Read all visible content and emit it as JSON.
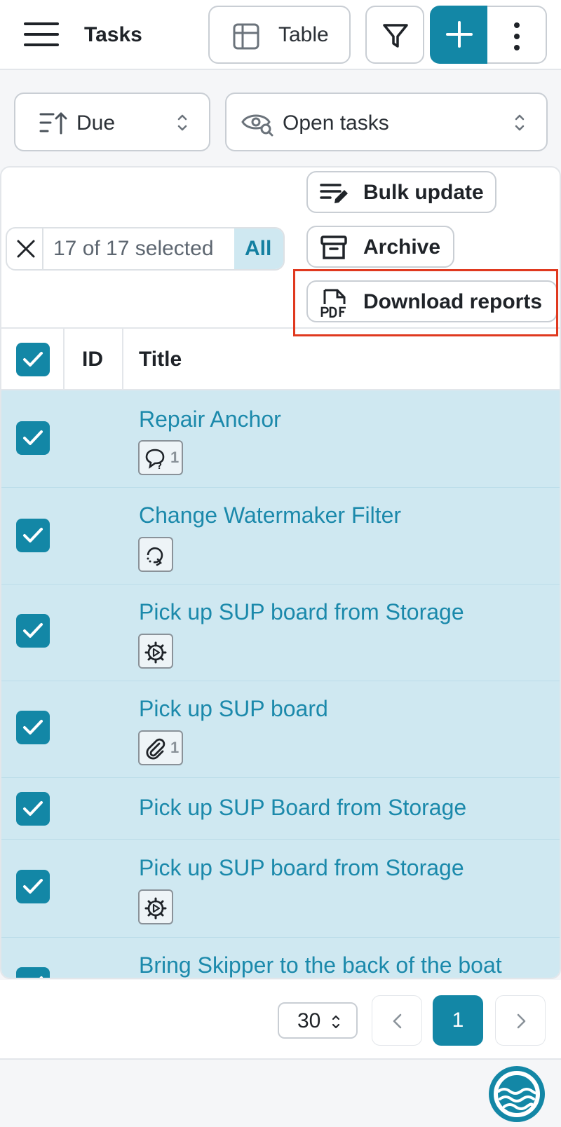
{
  "header": {
    "title": "Tasks",
    "view_button_label": "Table",
    "icons": [
      "menu-icon",
      "table-icon",
      "filter-icon",
      "plus-icon",
      "more-vertical-icon"
    ]
  },
  "toolbar": {
    "sort": {
      "label": "Due",
      "icon": "sort-icon"
    },
    "view_filter": {
      "label": "Open tasks",
      "icon": "eye-search-icon"
    }
  },
  "selection": {
    "count_text": "17 of 17 selected",
    "all_label": "All"
  },
  "actions": {
    "bulk_update": "Bulk update",
    "archive": "Archive",
    "download_reports": "Download reports"
  },
  "table": {
    "columns": [
      "ID",
      "Title"
    ],
    "rows": [
      {
        "title": "Repair Anchor",
        "badge_icon": "comment-question-icon",
        "badge_count": "1",
        "checked": true
      },
      {
        "title": "Change Watermaker Filter",
        "badge_icon": "recurring-icon",
        "badge_count": "",
        "checked": true
      },
      {
        "title": "Pick up SUP board from Storage",
        "badge_icon": "automation-gear-icon",
        "badge_count": "",
        "checked": true
      },
      {
        "title": "Pick up SUP board",
        "badge_icon": "paperclip-icon",
        "badge_count": "1",
        "checked": true
      },
      {
        "title": "Pick up SUP Board from Storage",
        "badge_icon": "",
        "badge_count": "",
        "checked": true
      },
      {
        "title": "Pick up SUP board from Storage",
        "badge_icon": "automation-gear-icon",
        "badge_count": "",
        "checked": true
      },
      {
        "title": "Bring Skipper to the back of the boat",
        "badge_icon": "",
        "badge_count": "",
        "checked": true
      }
    ]
  },
  "pagination": {
    "per_page": "30",
    "current_page": "1"
  },
  "colors": {
    "accent": "#1387a6",
    "selected_row": "#cfe8f1",
    "link": "#1b89ab",
    "highlight_box": "#e0391f"
  }
}
